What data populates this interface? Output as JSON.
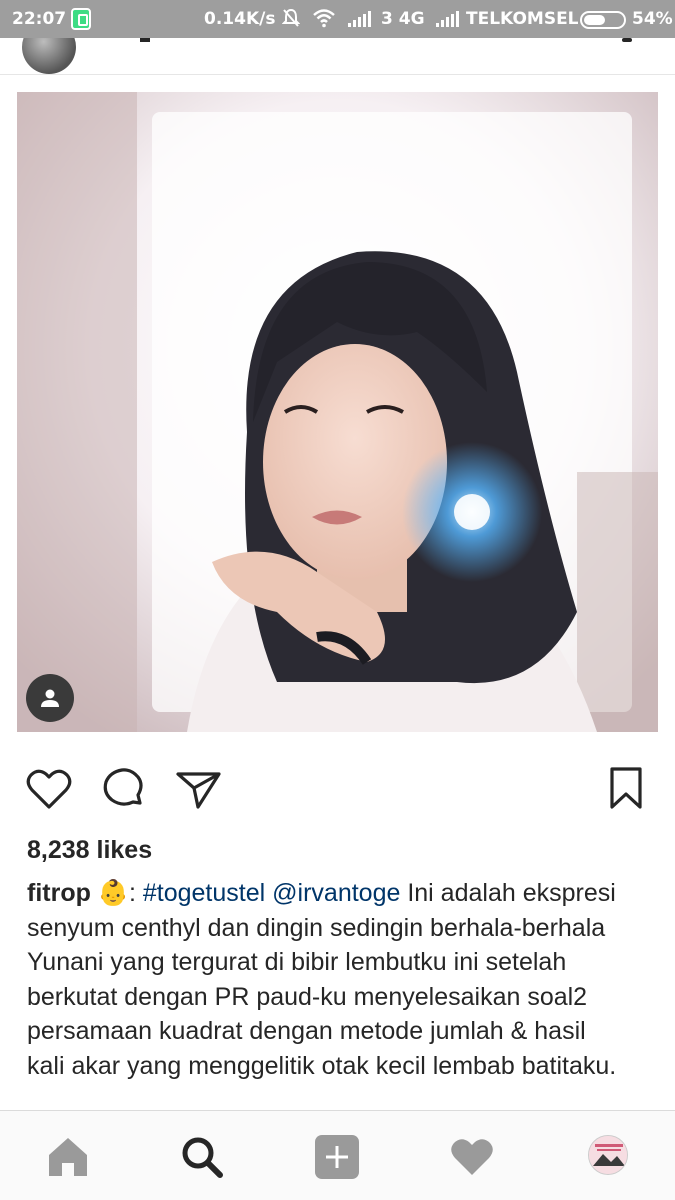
{
  "status_bar": {
    "time": "22:07",
    "speed": "0.14K/s",
    "network": "3 4G",
    "carrier": "TELKOMSEL",
    "battery_percent": "54%",
    "battery_level": 0.54
  },
  "post": {
    "photo_icon": "person-tag-icon",
    "likes": "8,238 likes",
    "caption": {
      "username": "fitrop",
      "emoji": "👶",
      "hashtag": "#togetustel",
      "mention": "@irvantoge",
      "line1_text": " Ini adalah ekspresi",
      "line2": "senyum centhyl dan dingin sedingin berhala-berhala",
      "line3": "Yunani yang tergurat di bibir lembutku ini setelah",
      "line4": "berkutat dengan PR paud-ku  menyelesaikan soal2",
      "line5": "persamaan kuadrat dengan metode jumlah & hasil",
      "line6": "kali akar yang menggelitik otak kecil lembab batitaku."
    },
    "more_indicator": "."
  },
  "actions": {
    "like_icon": "heart-icon",
    "comment_icon": "comment-icon",
    "share_icon": "send-icon",
    "save_icon": "bookmark-icon"
  },
  "bottom_nav": {
    "items": [
      "home-icon",
      "search-icon",
      "add-icon",
      "activity-heart-icon",
      "profile-avatar"
    ]
  }
}
